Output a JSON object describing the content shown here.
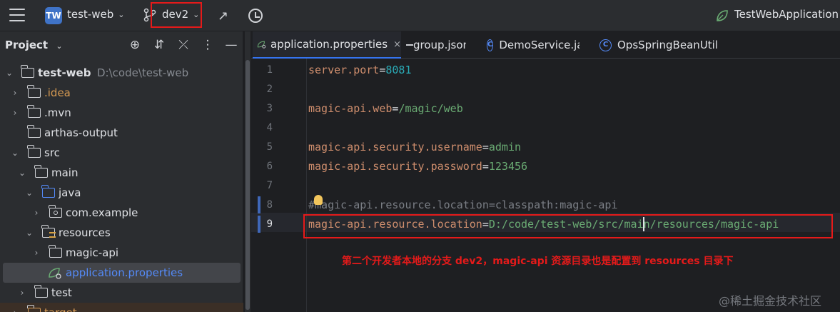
{
  "titlebar": {
    "project_badge": "TW",
    "project_name": "test-web",
    "branch": "dev2",
    "run_config": "TestWebApplication"
  },
  "project_panel": {
    "title": "Project",
    "tree": [
      {
        "label": "test-web",
        "path": "D:\\code\\test-web"
      },
      {
        "label": ".idea"
      },
      {
        "label": ".mvn"
      },
      {
        "label": "arthas-output"
      },
      {
        "label": "src"
      },
      {
        "label": "main"
      },
      {
        "label": "java"
      },
      {
        "label": "com.example"
      },
      {
        "label": "resources"
      },
      {
        "label": "magic-api"
      },
      {
        "label": "application.properties"
      },
      {
        "label": "test"
      },
      {
        "label": "target"
      }
    ]
  },
  "editor": {
    "tabs": [
      {
        "label": "application.properties",
        "close": "×"
      },
      {
        "label": "group.json"
      },
      {
        "label": "DemoService.java"
      },
      {
        "label": "OpsSpringBeanUtil"
      }
    ],
    "lines": [
      {
        "n": "1",
        "key": "server.port",
        "value": "8081"
      },
      {
        "n": "2",
        "text": ""
      },
      {
        "n": "3",
        "key": "magic-api.web",
        "value": "/magic/web"
      },
      {
        "n": "4",
        "text": ""
      },
      {
        "n": "5",
        "key": "magic-api.security.username",
        "value": "admin"
      },
      {
        "n": "6",
        "key": "magic-api.security.password",
        "value": "123456"
      },
      {
        "n": "7",
        "text": ""
      },
      {
        "n": "8",
        "text": "#magic-api.resource.location=classpath:magic-api"
      },
      {
        "n": "9",
        "key": "magic-api.resource.location",
        "value": "D:/code/test-web/src/main/resources/magic-api"
      }
    ],
    "annotation": "第二个开发者本地的分支 dev2，magic-api 资源目录也是配置到 resources 目录下",
    "watermark": "@稀土掘金技术社区"
  },
  "colors": {
    "accent": "#3574f0",
    "highlight_box": "#e51a1a",
    "keyword": "#cf8e6d",
    "string": "#6aab73",
    "number": "#2aacb8"
  }
}
